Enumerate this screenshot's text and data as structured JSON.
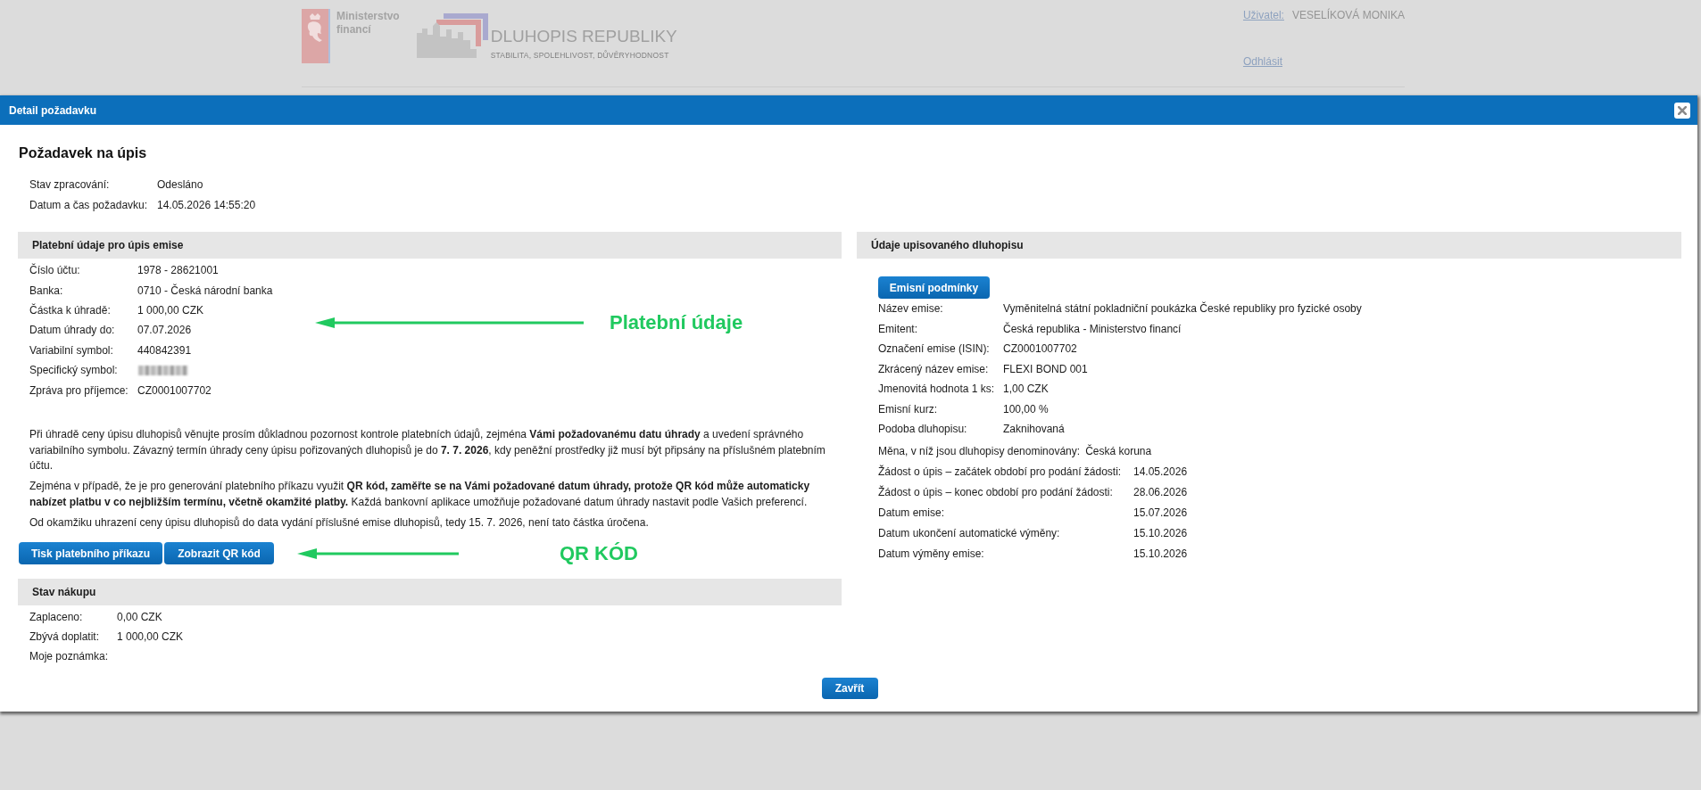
{
  "header": {
    "ministry_logo": [
      "Ministerstvo",
      "financí"
    ],
    "brand_name": "DLUHOPIS REPUBLIKY",
    "brand_tagline": "STABILITA, SPOLEHLIVOST, DŮVĚRYHODNOST",
    "user_label": "Uživatel:",
    "user_name": "VESELÍKOVÁ MONIKA",
    "logout": "Odhlásit"
  },
  "dialog": {
    "title": "Detail požadavku",
    "heading": "Požadavek na úpis",
    "status": [
      {
        "label": "Stav zpracování:",
        "value": "Odesláno"
      },
      {
        "label": "Datum a čas požadavku:",
        "value": "14.05.2026 14:55:20"
      }
    ],
    "payment": {
      "title": "Platební údaje pro úpis emise",
      "rows": [
        {
          "label": "Číslo účtu:",
          "value": "1978 - 28621001",
          "redacted": false
        },
        {
          "label": "Banka:",
          "value": "0710 - Česká národní banka",
          "redacted": false
        },
        {
          "label": "Částka k úhradě:",
          "value": "1 000,00 CZK",
          "redacted": false
        },
        {
          "label": "Datum úhrady do:",
          "value": "07.07.2026",
          "redacted": false
        },
        {
          "label": "Variabilní symbol:",
          "value": "440842391",
          "redacted": false
        },
        {
          "label": "Specifický symbol:",
          "redacted": true
        },
        {
          "label": "Zpráva pro příjemce:",
          "value": "CZ0001007702",
          "redacted": false
        }
      ],
      "rows_callout": "Platební údaje",
      "notes": [
        "Při úhradě ceny úpisu dluhopisů věnujte prosím důkladnou pozornost kontrole platebních údajů, zejména **Vámi požadovanému datu úhrady** a uvedení správného variabilního symbolu. Závazný termín úhrady ceny úpisu pořizovaných dluhopisů je do **7. 7. 2026**, kdy peněžní prostředky již musí být připsány na příslušném platebním účtu.",
        "Zejména v případě, že je pro generování platebního příkazu využit **QR kód, zaměřte se na Vámi požadované datum úhrady, protože QR kód může automaticky nabízet platbu v co nejbližším termínu, včetně okamžité platby.** Každá bankovní aplikace umožňuje požadované datum úhrady nastavit podle Vašich preferencí.",
        "Od okamžiku uhrazení ceny úpisu dluhopisů do data vydání příslušné emise dluhopisů, tedy 15. 7. 2026, není tato částka úročena."
      ],
      "buttons": [
        "Tisk platebního příkazu",
        "Zobrazit QR kód"
      ],
      "buttons_callout": "QR KÓD"
    },
    "purchase": {
      "title": "Stav nákupu",
      "rows": [
        {
          "label": "Zaplaceno:",
          "value": "0,00 CZK"
        },
        {
          "label": "Zbývá doplatit:",
          "value": "1 000,00 CZK"
        },
        {
          "label": "Moje poznámka:"
        }
      ]
    },
    "bond": {
      "title": "Údaje upisovaného dluhopisu",
      "button": "Emisní podmínky",
      "rows": [
        {
          "kind": "field",
          "label": "Název emise:",
          "value": "Vyměnitelná státní pokladniční poukázka České republiky pro fyzické osoby"
        },
        {
          "kind": "field",
          "label": "Emitent:",
          "value": "Česká republika - Ministerstvo financí"
        },
        {
          "kind": "field",
          "label": "Označení emise (ISIN):",
          "value": "CZ0001007702"
        },
        {
          "kind": "field",
          "label": "Zkrácený název emise:",
          "value": "FLEXI BOND 001"
        },
        {
          "kind": "field",
          "label": "Jmenovitá hodnota 1 ks:",
          "value": "1,00 CZK"
        },
        {
          "kind": "field",
          "label": "Emisní kurz:",
          "value": "100,00 %"
        },
        {
          "kind": "field",
          "label": "Podoba dluhopisu:",
          "value": "Zaknihovaná"
        },
        {
          "kind": "inline",
          "label": "Měna, v níž jsou dluhopisy denominovány:",
          "value": "Česká koruna"
        },
        {
          "kind": "period",
          "label": "Žádost o úpis – začátek období pro podání žádosti:",
          "value": "14.05.2026"
        },
        {
          "kind": "period",
          "label": "Žádost o úpis – konec období pro podání žádosti:",
          "value": "28.06.2026"
        },
        {
          "kind": "period",
          "label": "Datum emise:",
          "value": "15.07.2026"
        },
        {
          "kind": "period",
          "label": "Datum ukončení automatické výměny:",
          "value": "15.10.2026"
        },
        {
          "kind": "period",
          "label": "Datum výměny emise:",
          "value": "15.10.2026"
        }
      ]
    },
    "close_button": "Zavřít"
  }
}
